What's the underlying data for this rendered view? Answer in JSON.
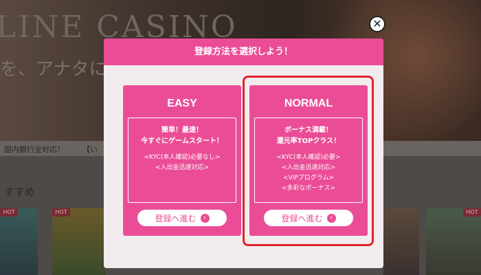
{
  "background": {
    "hero_title": "LINE CASINO",
    "hero_subtitle": "を、アナタに。",
    "bar_text_1": "国内銀行全対応！",
    "bar_text_2": "【い",
    "section_title": "すすめ",
    "hot_badge": "HOT"
  },
  "modal": {
    "header_title": "登録方法を選択しよう！",
    "close_icon": "close-circle-icon",
    "options": [
      {
        "title": "EASY",
        "headline": [
          "簡単！最速！",
          "今すぐにゲームスタート！"
        ],
        "features": [
          "<KYC(本人確認)必要なし>",
          "<入出金迅速対応>"
        ],
        "button_label": "登録へ進む",
        "button_icon": "chevron-right-circle-icon"
      },
      {
        "title": "NORMAL",
        "headline": [
          "ボーナス満載！",
          "還元率TOPクラス！"
        ],
        "features": [
          "<KYC(本人確認)必要>",
          "<入出金迅速対応>",
          "<VIPプログラム>",
          "<多彩なボーナス>"
        ],
        "button_label": "登録へ進む",
        "button_icon": "chevron-right-circle-icon"
      }
    ]
  },
  "colors": {
    "brand_pink": "#ea4d96",
    "highlight_red": "#e0232a",
    "modal_bg": "#f3ecef"
  }
}
